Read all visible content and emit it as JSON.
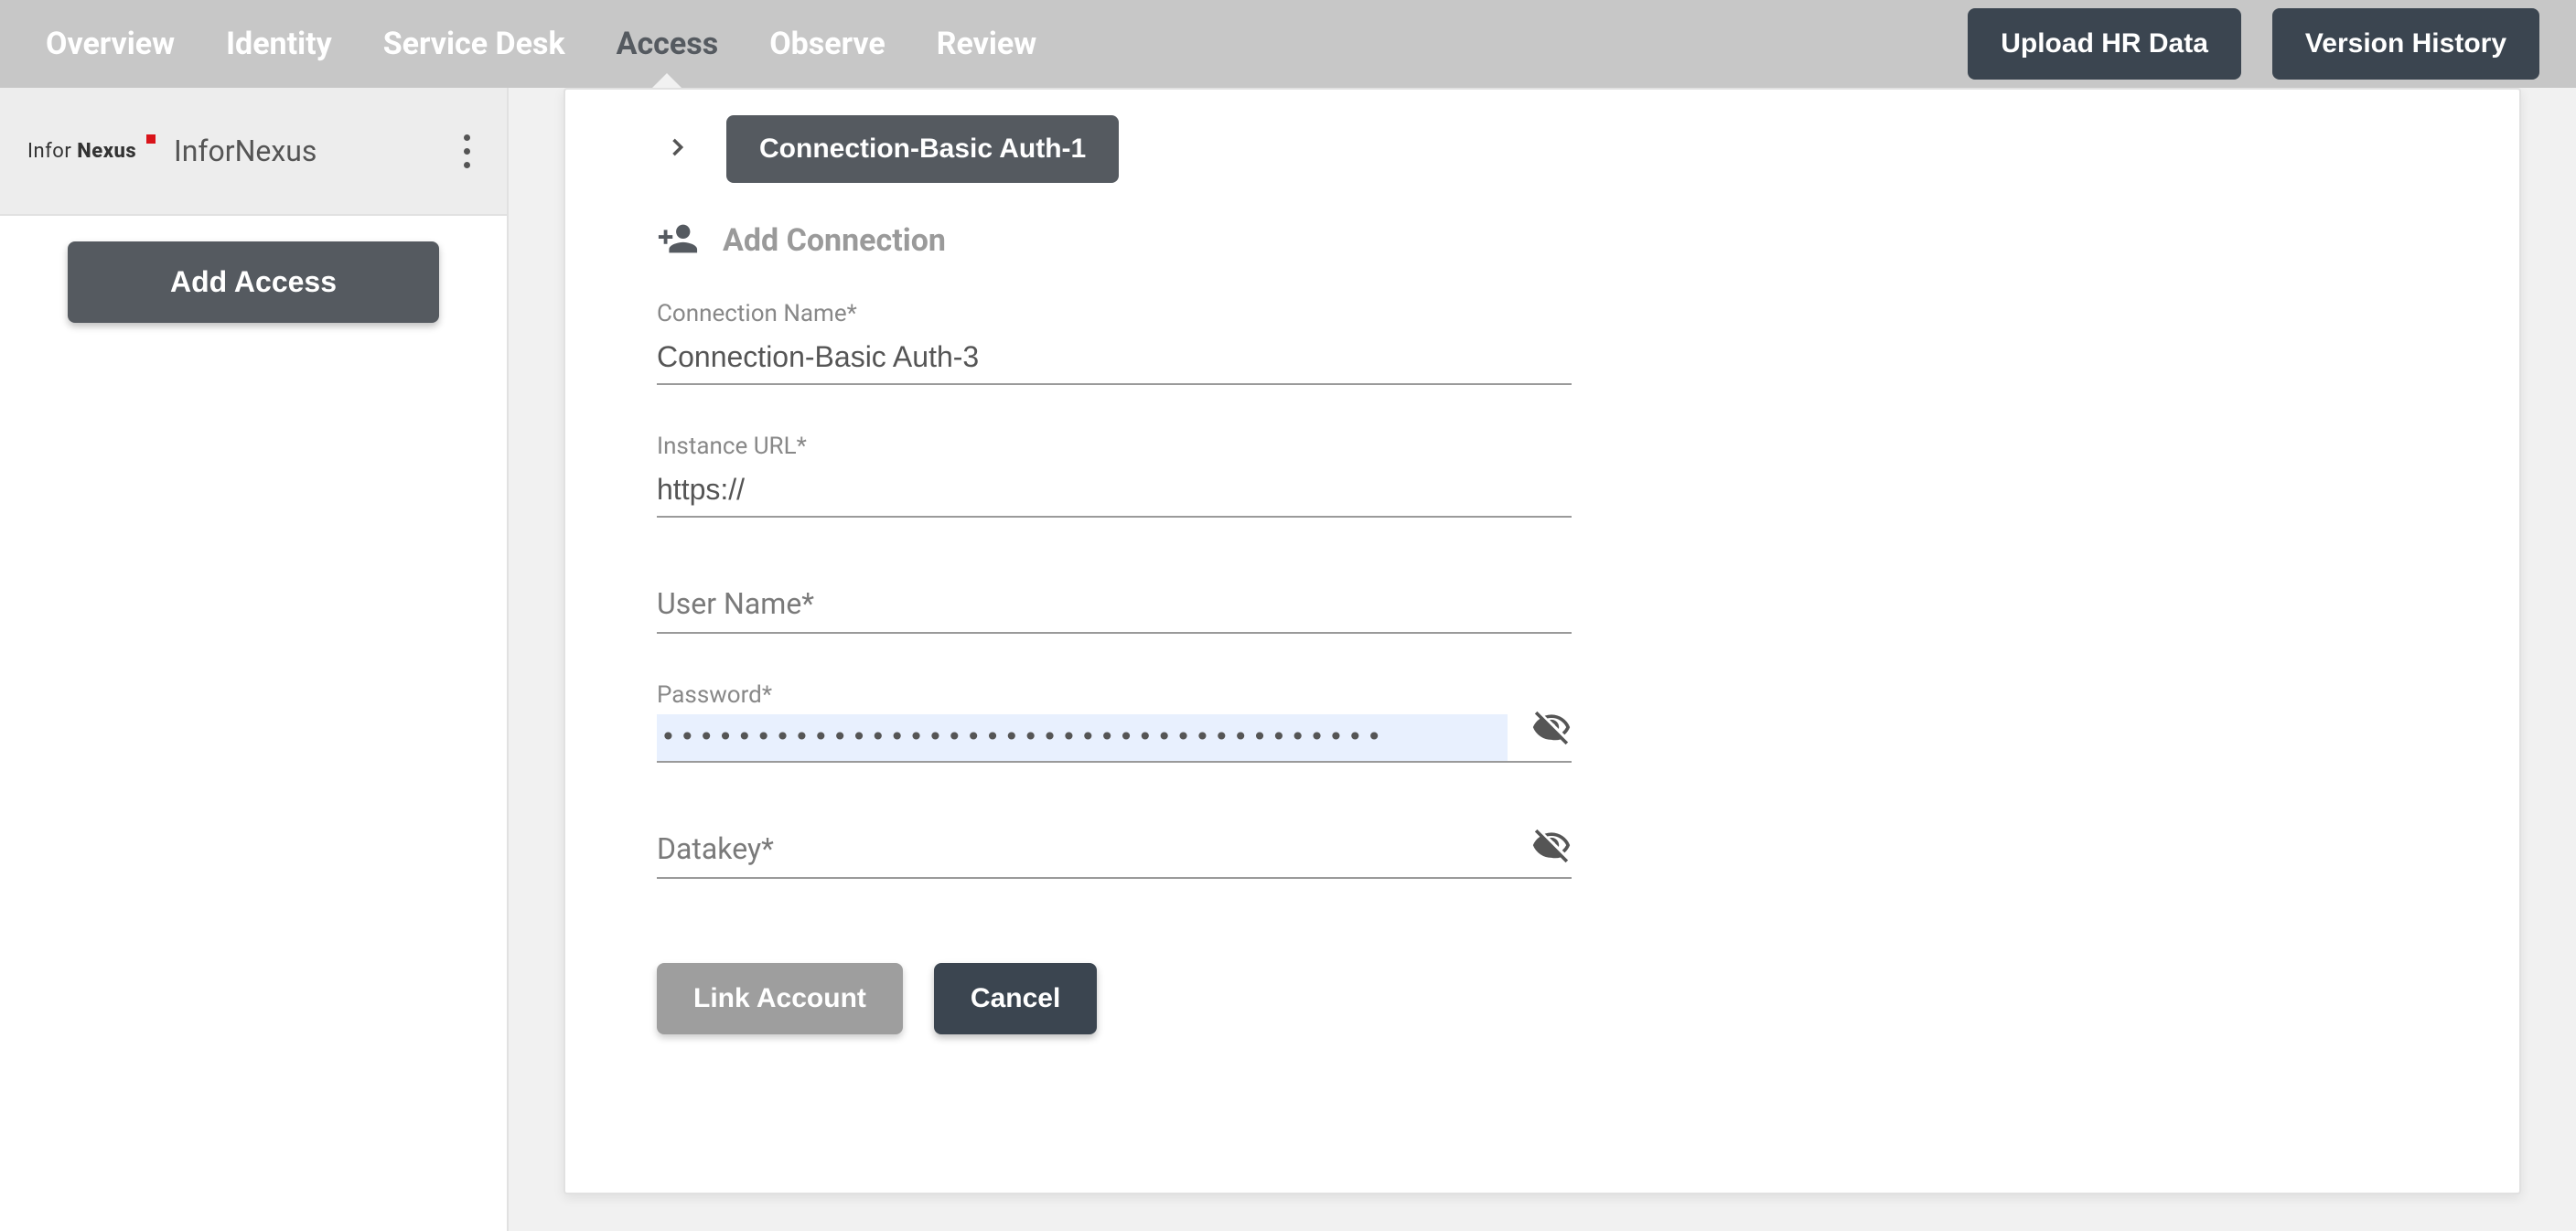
{
  "nav": {
    "tabs": [
      "Overview",
      "Identity",
      "Service Desk",
      "Access",
      "Observe",
      "Review"
    ],
    "active_index": 3,
    "upload_btn": "Upload HR Data",
    "version_btn": "Version History"
  },
  "sidebar": {
    "brand_part1": "Infor",
    "brand_part2": "Nexus",
    "item_label": "InforNexus",
    "add_access": "Add Access"
  },
  "card": {
    "connection_chip": "Connection-Basic Auth-1",
    "add_connection_label": "Add Connection",
    "form": {
      "conn_name": {
        "label": "Connection Name*",
        "value": "Connection-Basic Auth-3"
      },
      "instance_url": {
        "label": "Instance URL*",
        "value": "https://"
      },
      "user_name": {
        "placeholder": "User Name*",
        "value": ""
      },
      "password": {
        "label": "Password*",
        "value": "••••••••••••••••••••••••••••••••••••••"
      },
      "datakey": {
        "placeholder": "Datakey*",
        "value": ""
      }
    },
    "actions": {
      "link": "Link Account",
      "cancel": "Cancel"
    }
  }
}
